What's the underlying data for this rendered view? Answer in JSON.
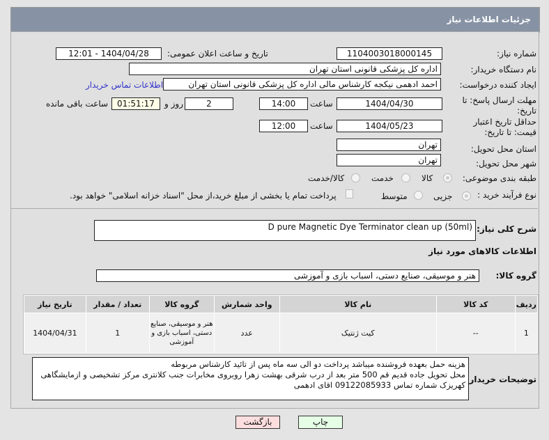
{
  "header": {
    "title": "جزئیات اطلاعات نیاز"
  },
  "form": {
    "need_number_label": "شماره نیاز:",
    "need_number": "1104003018000145",
    "announce_label": "تاریخ و ساعت اعلان عمومی:",
    "announce_value": "1404/04/28 - 12:01",
    "buyer_label": "نام دستگاه خریدار:",
    "buyer_value": "اداره کل پزشکی قانونی استان تهران",
    "creator_label": "ایجاد کننده درخواست:",
    "creator_value": "احمد ادهمی نیکجه کارشناس مالی اداره کل پزشکی قانونی استان تهران",
    "contact_link": "اطلاعات تماس خریدار",
    "deadline_label": "مهلت ارسال پاسخ: تا تاریخ:",
    "deadline_date": "1404/04/30",
    "time_label": "ساعت",
    "deadline_time": "14:00",
    "days": "2",
    "days_label": "روز و",
    "remaining": "01:51:17",
    "remaining_label": "ساعت باقی مانده",
    "validity_label": "حداقل تاریخ اعتبار قیمت: تا تاریخ:",
    "validity_date": "1404/05/23",
    "validity_time": "12:00",
    "province_label": "استان محل تحویل:",
    "province": "تهران",
    "city_label": "شهر محل تحویل:",
    "city": "تهران",
    "category_label": "طبقه بندی موضوعی:",
    "category_options": [
      "کالا",
      "خدمت",
      "کالا/خدمت"
    ],
    "process_label": "نوع فرآیند خرید :",
    "process_options": [
      "جزیی",
      "متوسط"
    ],
    "payment_note": "پرداخت تمام یا بخشی از مبلغ خرید،از محل \"اسناد خزانه اسلامی\" خواهد بود."
  },
  "description": {
    "label": "شرح کلی نیاز:",
    "value": "D pure Magnetic Dye Terminator clean up (50ml)"
  },
  "goods": {
    "section_title": "اطلاعات کالاهای مورد نیاز",
    "group_label": "گروه کالا:",
    "group_value": "هنر و موسیقی، صنایع دستی، اسباب بازی و آموزشی",
    "columns": [
      "ردیف",
      "کد کالا",
      "نام کالا",
      "واحد شمارش",
      "گروه کالا",
      "تعداد / مقدار",
      "تاریخ نیاز"
    ],
    "rows": [
      [
        "1",
        "--",
        "کیت ژنتیک",
        "عدد",
        "هنر و موسیقی، صنایع دستی، اسباب بازی و آموزشی",
        "1",
        "1404/04/31"
      ]
    ]
  },
  "notes": {
    "label": "توضیحات خریدار:",
    "value": "هزینه حمل بعهده فروشنده میباشد پرداخت دو الی سه ماه پس از تائید کارشناس مربوطه\nمحل تحویل جاده قدیم قم 500 متر بعد از درب شرقی بهشت زهرا روبروی مخابرات جنب کلانتری مرکز تشخیصی و ازمایشگاهی کهریزک شماره تماس 09122085933 اقای ادهمی"
  },
  "buttons": {
    "print": "چاپ",
    "back": "بازگشت"
  }
}
